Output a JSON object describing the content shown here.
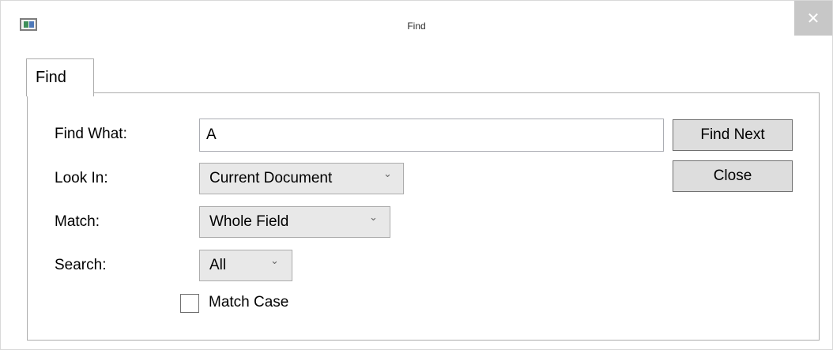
{
  "window": {
    "title": "Find",
    "close_glyph": "✕",
    "app_icon": "window-icon"
  },
  "tabs": [
    {
      "label": "Find",
      "selected": true
    }
  ],
  "form": {
    "find_what_label": "Find What:",
    "find_what_value": "A",
    "look_in_label": "Look In:",
    "look_in_value": "Current Document",
    "match_label": "Match:",
    "match_value": "Whole Field",
    "search_label": "Search:",
    "search_value": "All",
    "match_case_label": "Match Case",
    "match_case_checked": false,
    "dropdown_glyph": "⌄"
  },
  "buttons": {
    "find_next": "Find Next",
    "close": "Close"
  },
  "colors": {
    "button_bg": "#dddddd",
    "combo_bg": "#e8e8e8",
    "close_button_bg": "#c7c7c7"
  }
}
